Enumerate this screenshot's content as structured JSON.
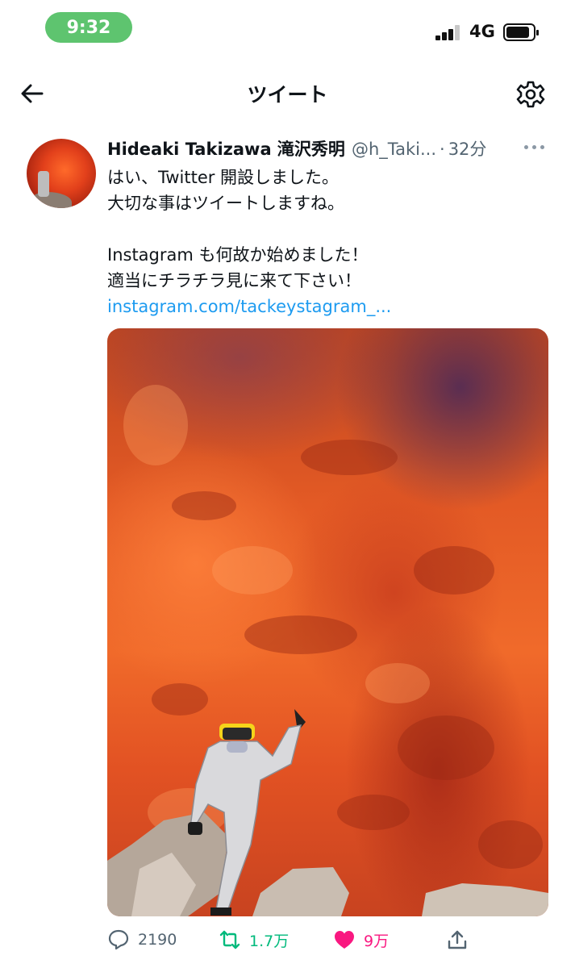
{
  "status_bar": {
    "time": "9:32",
    "network": "4G",
    "time_pill_color": "#5ec46f"
  },
  "nav": {
    "title": "ツイート",
    "icons": [
      "back-arrow-icon",
      "gear-icon"
    ]
  },
  "tweet": {
    "display_name": "Hideaki Takizawa 滝沢秀明",
    "handle": "@h_Taki...",
    "separator": "·",
    "timestamp": "32分",
    "lines": [
      "はい、Twitter 開設しました。",
      "大切な事はツイートしますね。",
      "",
      "Instagram も何故か始めました！",
      "適当にチラチラ見に来て下さい！"
    ],
    "link": "instagram.com/tackeystagram_..."
  },
  "actions": {
    "reply_count": "2190",
    "retweet_count": "1.7万",
    "like_count": "9万",
    "colors": {
      "retweet": "#00ba7c",
      "like": "#f91880",
      "muted": "#536471"
    }
  }
}
